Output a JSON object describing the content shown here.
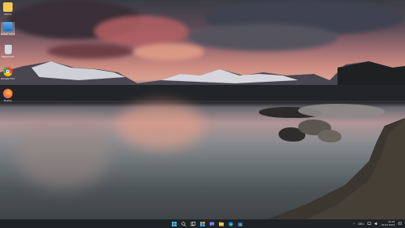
{
  "desktop": {
    "icons": [
      {
        "label": "Admin",
        "icon": "folder-icon",
        "color": "#f2c94c"
      },
      {
        "label": "Dieser Computer",
        "icon": "computer-icon",
        "color": "#3d8fd6"
      },
      {
        "label": "Papierkorb",
        "icon": "recycle-bin-icon",
        "color": "#cfd8dc"
      },
      {
        "label": "Google Chrome",
        "icon": "chrome-icon",
        "color": "#34a853"
      },
      {
        "label": "Firefox",
        "icon": "firefox-icon",
        "color": "#ff7139"
      }
    ]
  },
  "taskbar": {
    "buttons": [
      "windows-start-icon",
      "search-icon",
      "task-view-icon",
      "widgets-icon",
      "chat-icon",
      "file-explorer-icon",
      "edge-icon",
      "store-icon"
    ],
    "tray": {
      "chevron": "^",
      "language": "DEU",
      "time": "10:49",
      "date": "04.07.2022"
    }
  }
}
